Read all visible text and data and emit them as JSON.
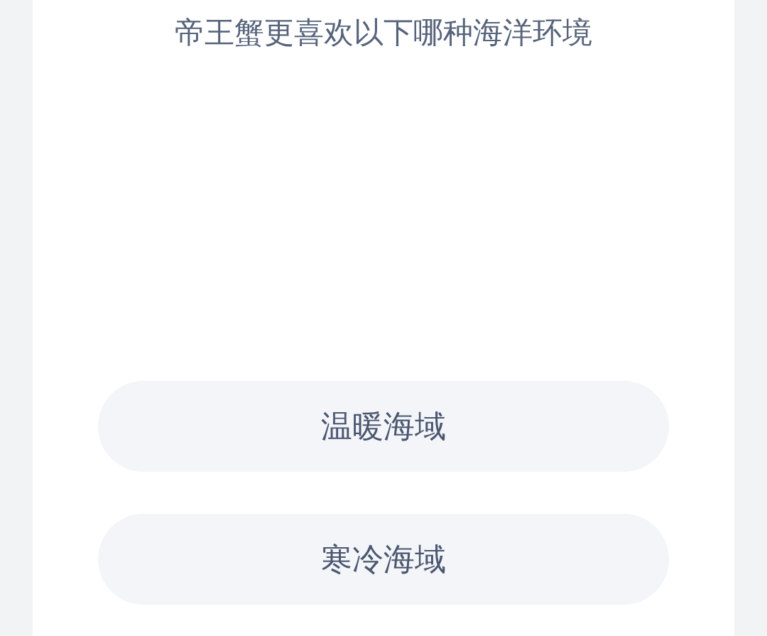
{
  "question": "帝王蟹更喜欢以下哪种海洋环境",
  "options": [
    "温暖海域",
    "寒冷海域"
  ]
}
